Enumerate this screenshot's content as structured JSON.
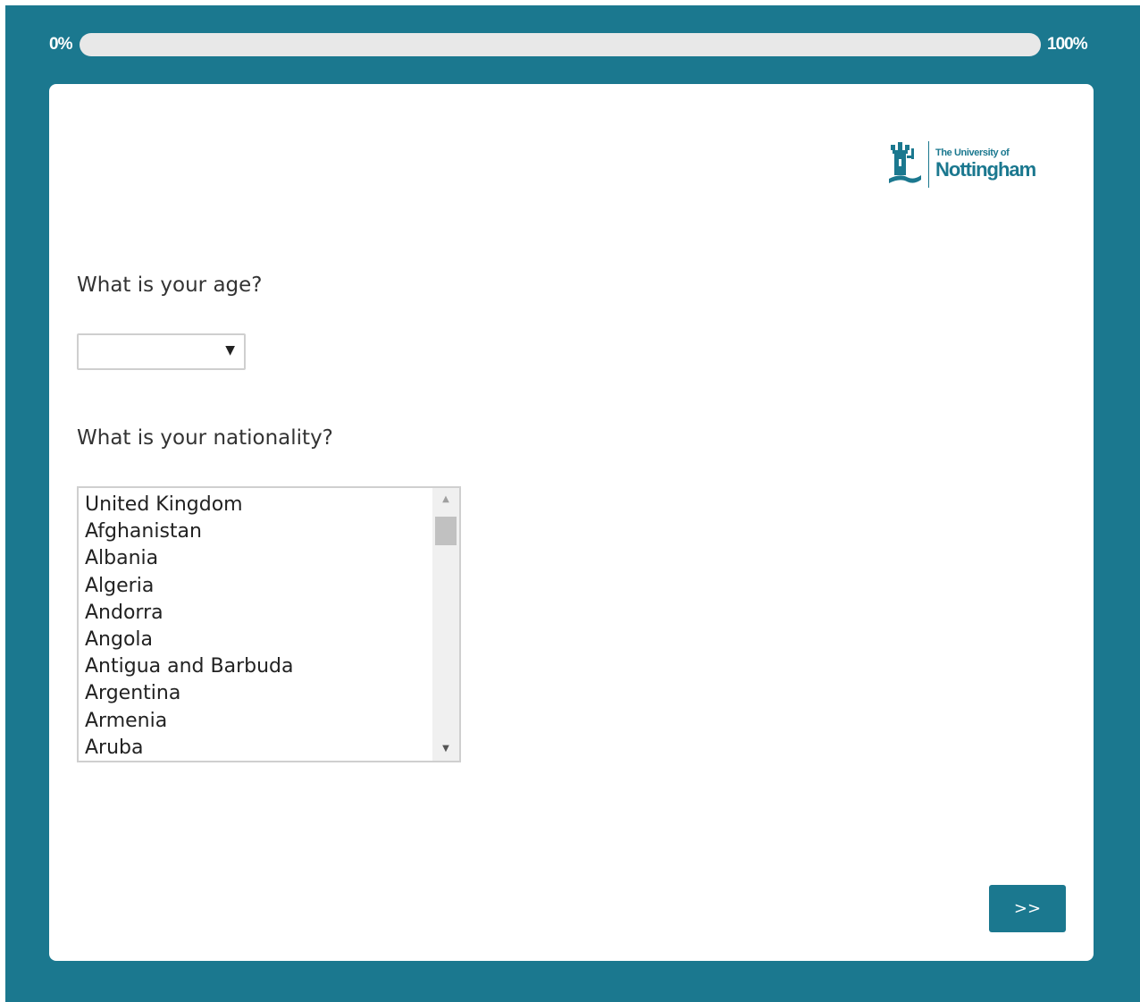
{
  "progress": {
    "start_label": "0%",
    "end_label": "100%",
    "percent": 0
  },
  "logo": {
    "icon": "castle-crest-icon",
    "line1": "The University of",
    "line2": "Nottingham"
  },
  "questions": {
    "age": {
      "label": "What is your age?",
      "selected": ""
    },
    "nationality": {
      "label": "What is your nationality?",
      "options": [
        "United Kingdom",
        "Afghanistan",
        "Albania",
        "Algeria",
        "Andorra",
        "Angola",
        "Antigua and Barbuda",
        "Argentina",
        "Armenia",
        "Aruba"
      ]
    }
  },
  "navigation": {
    "next_label": ">>"
  },
  "colors": {
    "brand": "#1b788f",
    "track": "#e8e8e8"
  }
}
